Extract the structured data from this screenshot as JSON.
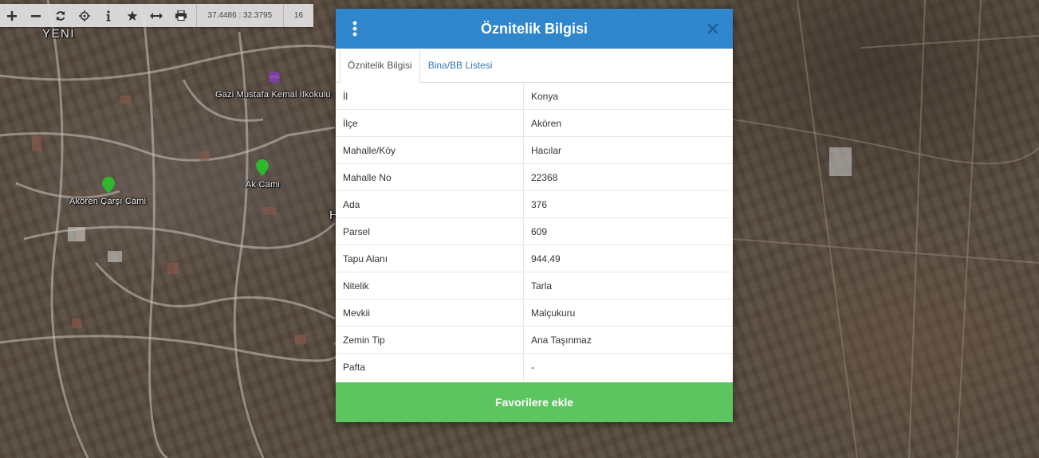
{
  "toolbar": {
    "buttons": [
      {
        "icon": "zoom-in-icon"
      },
      {
        "icon": "zoom-out-icon"
      },
      {
        "icon": "refresh-icon"
      },
      {
        "icon": "locate-icon"
      },
      {
        "icon": "info-icon"
      },
      {
        "icon": "star-icon"
      },
      {
        "icon": "measure-icon"
      },
      {
        "icon": "print-icon"
      }
    ],
    "coordinates": "37.4486 : 32.3795",
    "zoom_level": "16"
  },
  "map": {
    "labels": {
      "neighborhood": "YENİ",
      "school": "Gazi Mustafa Kemal İlkokulu",
      "mosque_1": "Akören Çarşı Cami",
      "mosque_2": "Ak Cami",
      "partial": "H"
    },
    "marker_colors": {
      "mosque": "#2eb82e",
      "school": "#7b3fa0"
    }
  },
  "modal": {
    "title": "Öznitelik Bilgisi",
    "tabs": [
      {
        "label": "Öznitelik Bilgisi",
        "active": true
      },
      {
        "label": "Bina/BB Listesi",
        "active": false
      }
    ],
    "rows": [
      {
        "key": "İl",
        "value": "Konya"
      },
      {
        "key": "İlçe",
        "value": "Akören"
      },
      {
        "key": "Mahalle/Köy",
        "value": "Hacılar"
      },
      {
        "key": "Mahalle No",
        "value": "22368"
      },
      {
        "key": "Ada",
        "value": "376"
      },
      {
        "key": "Parsel",
        "value": "609"
      },
      {
        "key": "Tapu Alanı",
        "value": "944,49"
      },
      {
        "key": "Nitelik",
        "value": "Tarla"
      },
      {
        "key": "Mevkii",
        "value": "Malçukuru"
      },
      {
        "key": "Zemin Tip",
        "value": "Ana Taşınmaz"
      },
      {
        "key": "Pafta",
        "value": "-"
      }
    ],
    "favorite_button": "Favorilere ekle",
    "colors": {
      "header": "#2f86cd",
      "favorite": "#5cc560",
      "tab_link": "#337ab7"
    }
  }
}
